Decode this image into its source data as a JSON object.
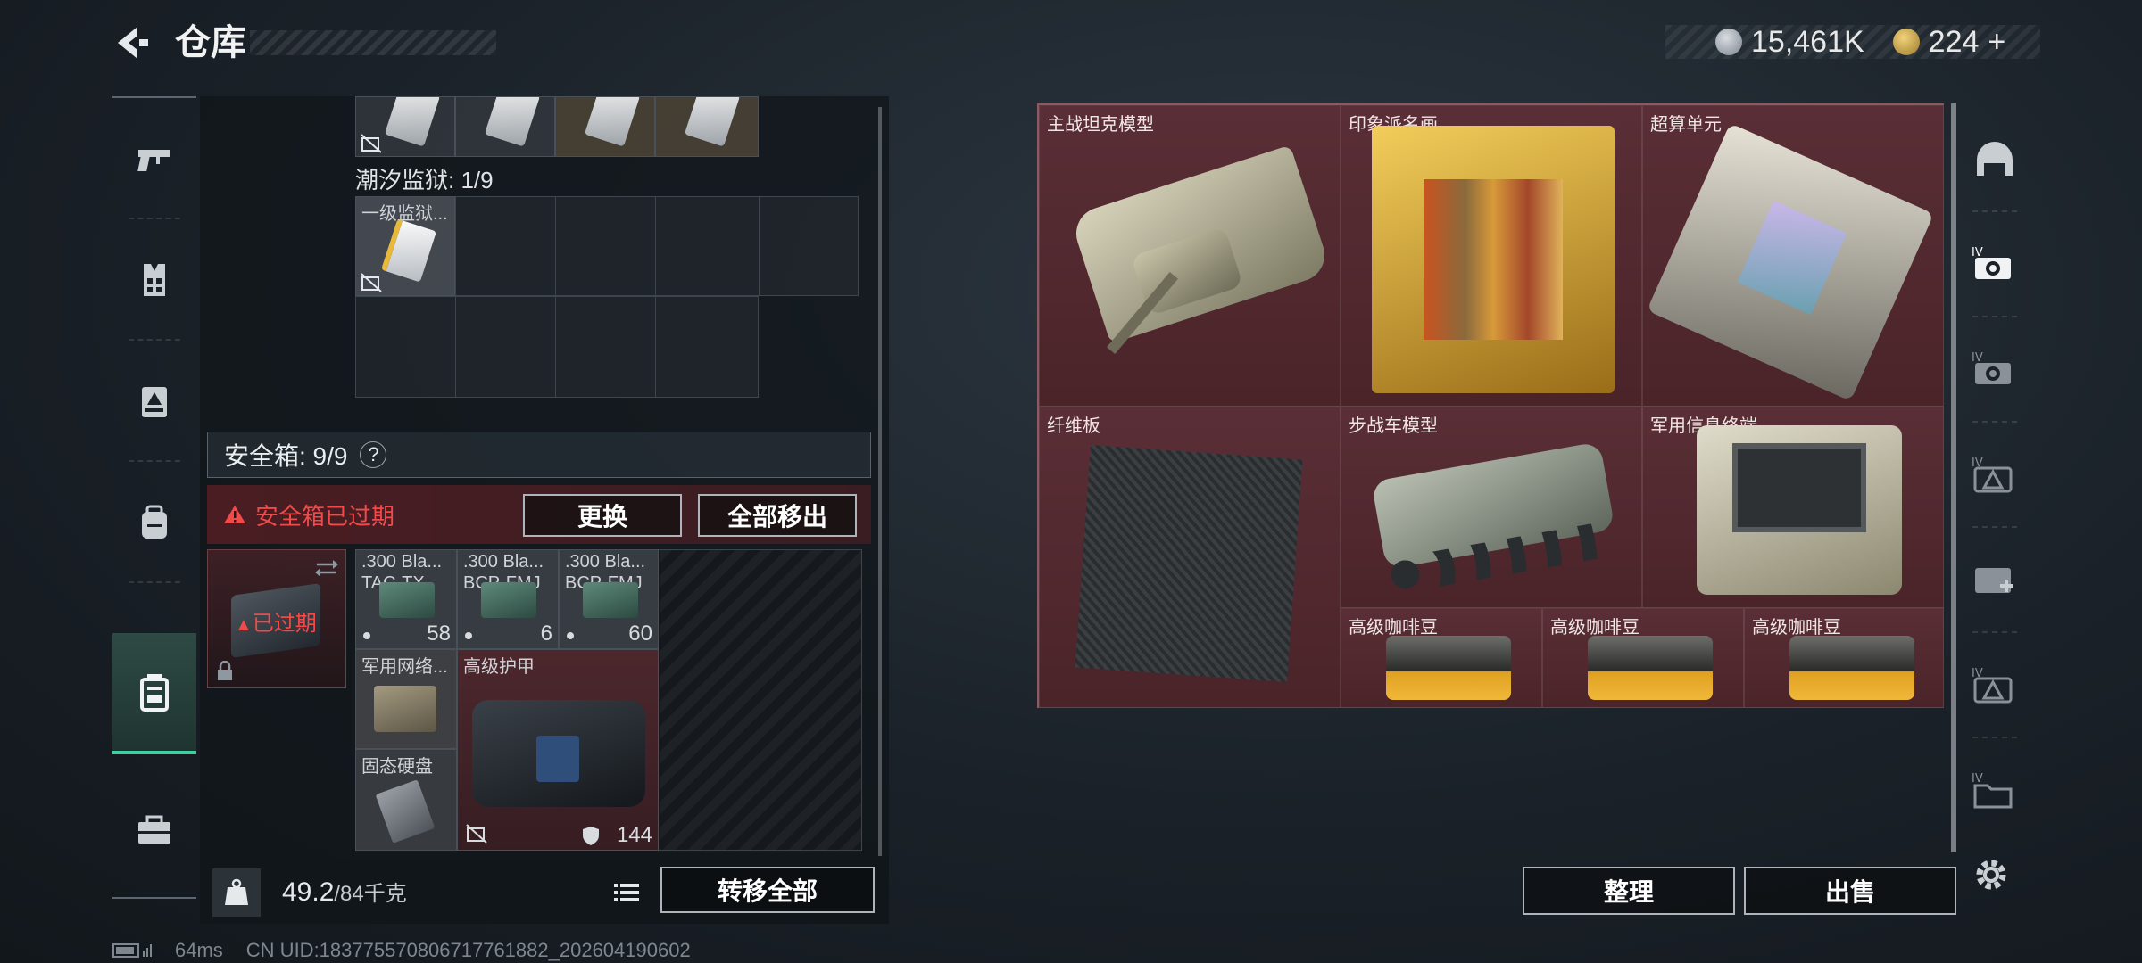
{
  "header": {
    "title": "仓库",
    "currency": {
      "coins": "15,461K",
      "premium": "224",
      "plus": "+"
    }
  },
  "categories": [
    {
      "icon": "gun-icon"
    },
    {
      "icon": "vest-icon"
    },
    {
      "icon": "rig-icon"
    },
    {
      "icon": "backpack-icon"
    },
    {
      "icon": "safebox-icon",
      "active": true
    },
    {
      "icon": "toolbox-icon"
    }
  ],
  "left_panel": {
    "prison_label": "潮汐监狱: 1/9",
    "prison_item": "一级监狱...",
    "safebox_title": "安全箱: 9/9",
    "safebox_help": "?",
    "expired_warning": "安全箱已过期",
    "replace_button": "更换",
    "remove_all_button": "全部移出",
    "expired_label": "已过期",
    "ammo": [
      {
        "line1": ".300 Bla...",
        "line2": "TAC-TX",
        "count": "58"
      },
      {
        "line1": ".300 Bla...",
        "line2": "BCP-FMJ",
        "count": "6"
      },
      {
        "line1": ".300 Bla...",
        "line2": "BCP-FMJ",
        "count": "60"
      }
    ],
    "military_net": "军用网络...",
    "armor": "高级护甲",
    "ssd": "固态硬盘",
    "armor_durability": "144"
  },
  "footer": {
    "weight_current": "49.2",
    "weight_max": "/84千克",
    "transfer_all_button": "转移全部"
  },
  "right_stash": {
    "items": [
      "主战坦克模型",
      "印象派名画",
      "超算单元",
      "纤维板",
      "步战车模型",
      "军用信息终端",
      "高级咖啡豆",
      "高级咖啡豆",
      "高级咖啡豆"
    ],
    "sort_button": "整理",
    "sell_button": "出售"
  },
  "filters": [
    {
      "icon": "helmet-icon"
    },
    {
      "icon": "tier4-vision-icon"
    },
    {
      "icon": "tier4-vision-icon"
    },
    {
      "icon": "tier4-triangle-icon"
    },
    {
      "icon": "medkit-icon"
    },
    {
      "icon": "tier4-triangle-icon"
    },
    {
      "icon": "tier4-folder-icon"
    }
  ],
  "status": {
    "ping": "64ms",
    "uid": "CN UID:1837755708067177618​82_202604190602"
  },
  "colors": {
    "accent_green": "#3fd0a2",
    "warning_red": "#f04a4a",
    "stash_bg": "#4a2a30"
  }
}
